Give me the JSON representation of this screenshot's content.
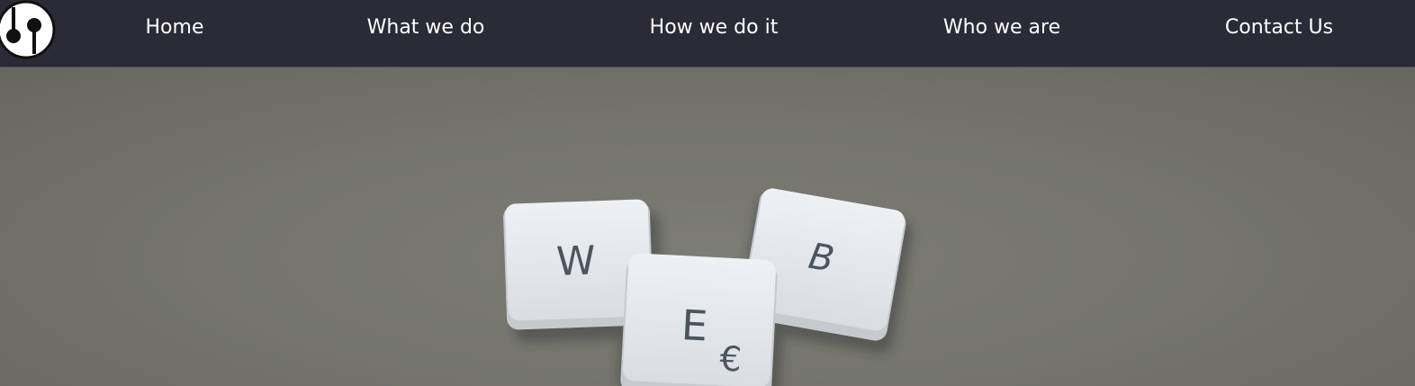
{
  "nav": {
    "items": [
      {
        "label": "Home"
      },
      {
        "label": "What we do"
      },
      {
        "label": "How we do it"
      },
      {
        "label": "Who we are"
      },
      {
        "label": "Contact Us"
      }
    ]
  },
  "logo": {
    "icon": "bp-logo-icon"
  },
  "hero": {
    "tiles": [
      {
        "letter": "W"
      },
      {
        "letter": "E",
        "sub": "€"
      },
      {
        "letter": "B"
      }
    ]
  },
  "colors": {
    "navbar_bg": "#2a2b36",
    "nav_text": "#ffffff",
    "hero_bg": "#76766f",
    "tile_face": "#e4e7ea",
    "tile_letter": "#4a5560"
  }
}
